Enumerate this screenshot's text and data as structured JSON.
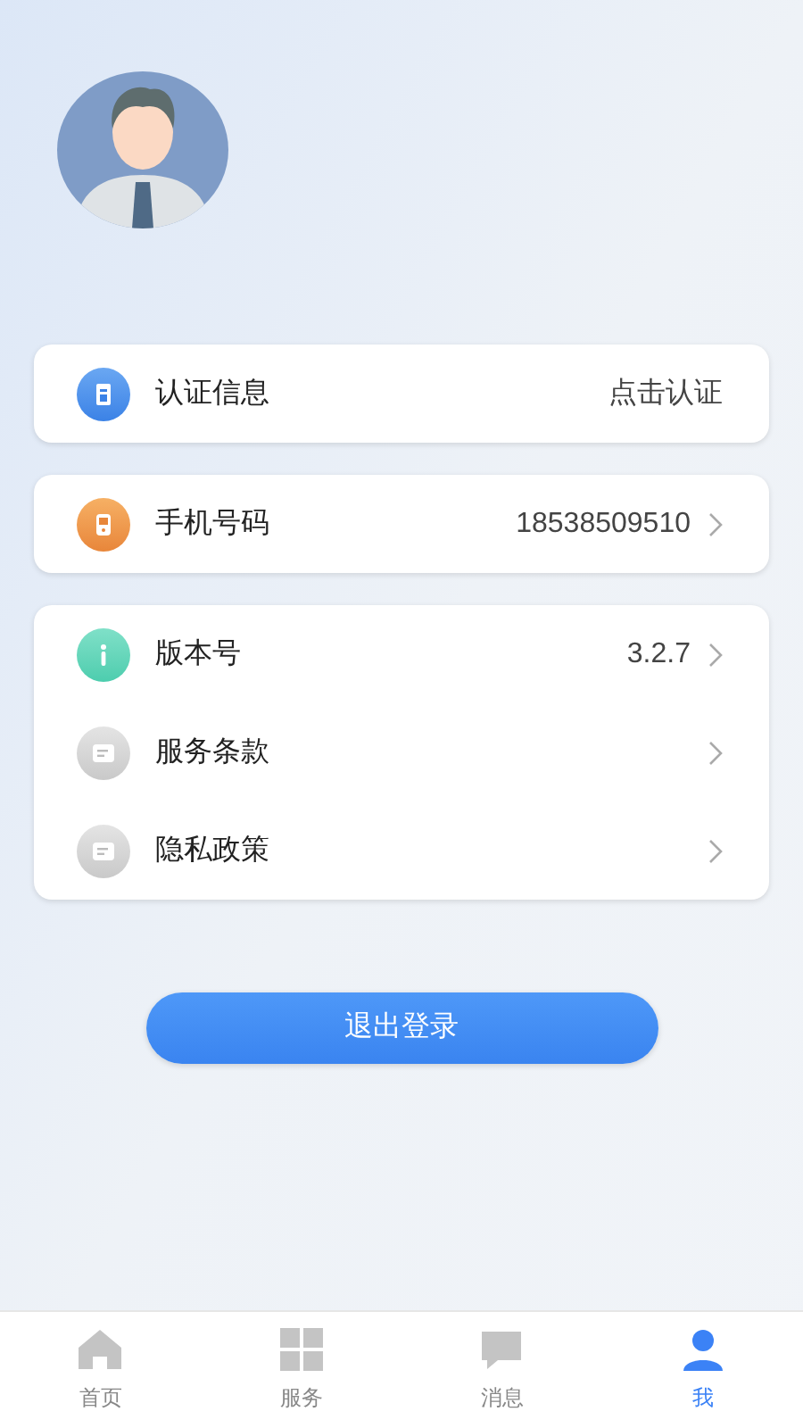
{
  "groups": [
    {
      "rows": [
        {
          "kind": "badge",
          "label": "认证信息",
          "value": "点击认证",
          "chevron": false
        }
      ]
    },
    {
      "rows": [
        {
          "kind": "phone",
          "label": "手机号码",
          "value": "18538509510",
          "chevron": true
        }
      ]
    },
    {
      "rows": [
        {
          "kind": "info",
          "label": "版本号",
          "value": "3.2.7",
          "chevron": true
        },
        {
          "kind": "doc",
          "label": "服务条款",
          "chevron": true
        },
        {
          "kind": "doc",
          "label": "隐私政策",
          "chevron": true
        }
      ]
    }
  ],
  "logout_button": "退出登录",
  "tab_bar": [
    {
      "kind": "home",
      "label": "首页",
      "selected": false
    },
    {
      "kind": "grid",
      "label": "服务",
      "selected": false
    },
    {
      "kind": "chat",
      "label": "消息",
      "selected": false
    },
    {
      "kind": "person",
      "label": "我",
      "selected": true
    }
  ]
}
